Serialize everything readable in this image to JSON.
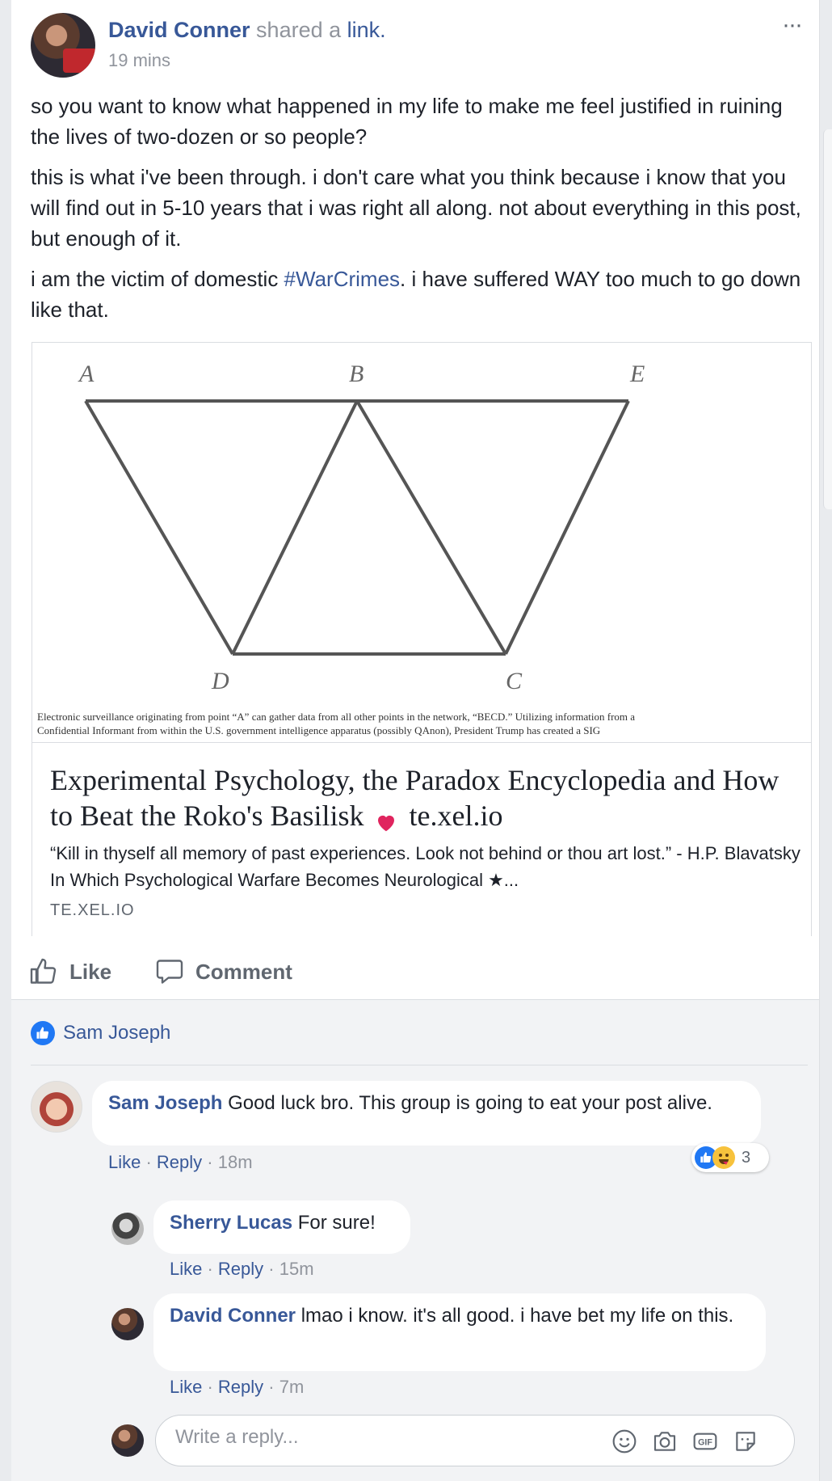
{
  "post": {
    "author": "David Conner",
    "action": "shared a",
    "action_link": "link.",
    "time": "19 mins",
    "more": "···",
    "para1": "so you want to know what happened in my life to make me feel justified in ruining the lives of two-dozen or so people?",
    "para2": "this is what i've been through. i don't care what you think because i know that you will find out in 5-10 years that i was right all along. not about everything in this post, but enough of it.",
    "para3_a": "i am the victim of domestic ",
    "para3_hashtag": "#WarCrimes",
    "para3_b": ". i have suffered WAY too much to go down like that."
  },
  "share": {
    "diagram_labels": {
      "a": "A",
      "b": "B",
      "e": "E",
      "d": "D",
      "c": "C"
    },
    "caption_1": "Electronic surveillance originating from point “A” can gather data from all other points in the network, “BECD.” Utilizing information from a",
    "caption_2": "Confidential Informant from within the U.S. government intelligence apparatus (possibly QAnon), President Trump has created a SIG",
    "title_a": "Experimental Psychology, the Paradox Encyclopedia and How to Beat the Roko's Basilisk",
    "title_b": "te.xel.io",
    "description": "“Kill in thyself all memory of past experiences. Look not behind or thou art lost.” - H.P. Blavatsky In Which Psychological Warfare Becomes Neurological ★...",
    "domain": "TE.XEL.IO"
  },
  "actions": {
    "like": "Like",
    "comment": "Comment"
  },
  "likes": {
    "liker": "Sam Joseph"
  },
  "comments": [
    {
      "name": "Sam Joseph",
      "text": "Good luck bro. This group is going to eat your post alive.",
      "like": "Like",
      "reply": "Reply",
      "time": "18m",
      "reaction_count": "3"
    },
    {
      "name": "Sherry Lucas",
      "text": "For sure!",
      "like": "Like",
      "reply": "Reply",
      "time": "15m"
    },
    {
      "name": "David Conner",
      "text": "lmao i know. it's all good. i have bet my life on this.",
      "like": "Like",
      "reply": "Reply",
      "time": "7m"
    }
  ],
  "reply_box": {
    "placeholder": "Write a reply..."
  },
  "icons": [
    "thumbs-up-icon",
    "comment-icon",
    "emoji-icon",
    "camera-icon",
    "gif-icon",
    "sticker-icon",
    "heart-icon",
    "more-icon"
  ],
  "colors": {
    "link": "#385898",
    "meta": "#90949c",
    "like_blue": "#2078f4",
    "heart_red": "#e0245e"
  }
}
